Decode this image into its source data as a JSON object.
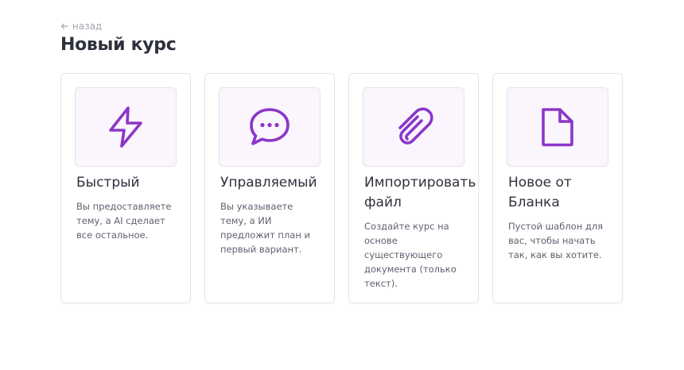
{
  "header": {
    "back_label": "назад",
    "title": "Новый курс"
  },
  "theme": {
    "accent": "#8b36c9",
    "icon_bg": "#fbf5fd",
    "card_border": "#e4e5ea"
  },
  "cards": [
    {
      "icon": "lightning-icon",
      "title": "Быстрый",
      "description": "Вы предоставляете\nтему, а AI сделает\nвсе остальное."
    },
    {
      "icon": "chat-bubble-icon",
      "title": "Управляемый",
      "description": "Вы указываете\nтему, а ИИ\nпредложит план и\nпервый вариант."
    },
    {
      "icon": "paperclip-icon",
      "title": "Импортировать\nфайл",
      "description": "Создайте курс на\nоснове\nсуществующего\nдокумента (только\nтекст)."
    },
    {
      "icon": "document-icon",
      "title": "Новое от\nБланка",
      "description": "Пустой шаблон для\nвас, чтобы начать\nтак, как вы хотите."
    }
  ]
}
